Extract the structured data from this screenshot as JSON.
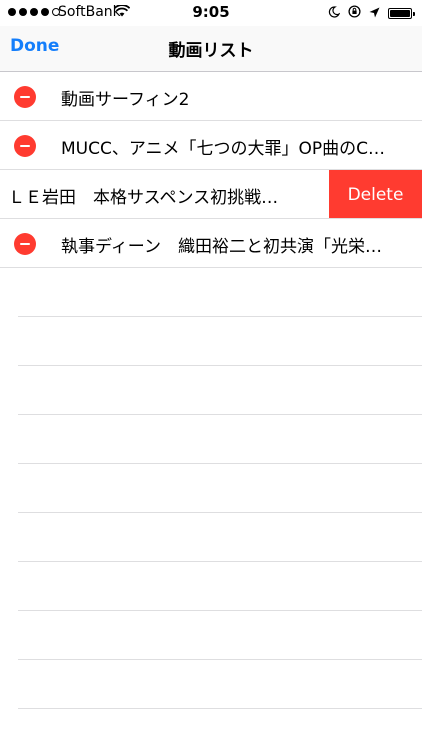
{
  "status_bar": {
    "carrier": "SoftBank",
    "time": "9:05",
    "signal_bars_filled": 4,
    "signal_bars_total": 5,
    "battery_level": 1.0,
    "icons": [
      "wifi-icon",
      "moon-icon",
      "rotation-lock-icon",
      "location-arrow-icon",
      "battery-icon"
    ]
  },
  "navbar": {
    "done_label": "Done",
    "title": "動画リスト",
    "tint_color": "#147efb"
  },
  "list": {
    "items": [
      {
        "label": "動画サーフィン2"
      },
      {
        "label": "MUCC、アニメ「七つの大罪」OP曲のC…"
      },
      {
        "label": "ＬＥ岩田　本格サスペンス初挑戦…",
        "swiped": true,
        "action_label": "Delete"
      },
      {
        "label": "執事ディーン　織田裕二と初共演「光栄…"
      }
    ],
    "delete_color": "#ff3b30"
  }
}
